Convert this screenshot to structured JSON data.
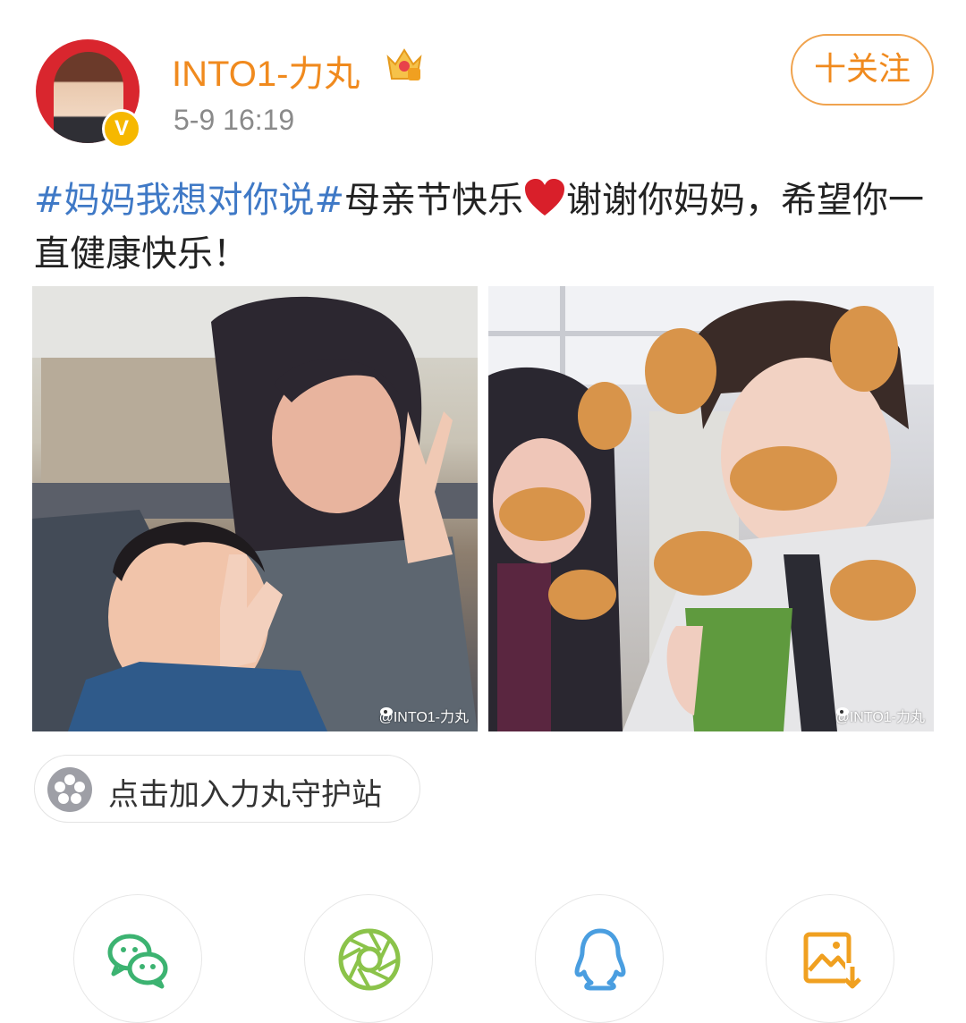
{
  "post": {
    "username": "INTO1-力丸",
    "timestamp": "5-9 16:19",
    "verified_badge": "V",
    "text": {
      "topic": "#妈妈我想对你说#",
      "part1": "母亲节快乐",
      "emoji": "heart",
      "part2": "谢谢你妈妈，希望你一直健康快乐！"
    },
    "follow_label": "十关注",
    "photos": [
      {
        "watermark": "@INTO1-力丸"
      },
      {
        "watermark": "@INTO1-力丸"
      }
    ],
    "supertopic_label": "点击加入力丸守护站"
  },
  "share_bar": {
    "items": [
      "wechat-icon",
      "moments-icon",
      "qq-icon",
      "save-image-icon"
    ]
  },
  "colors": {
    "username": "#f08a1e",
    "topic_link": "#3f79c6",
    "follow_border": "#f0a34e",
    "wechat": "#3cb371",
    "moments": "#8bc34a",
    "qq": "#4a9ee0",
    "save": "#f0a020"
  }
}
